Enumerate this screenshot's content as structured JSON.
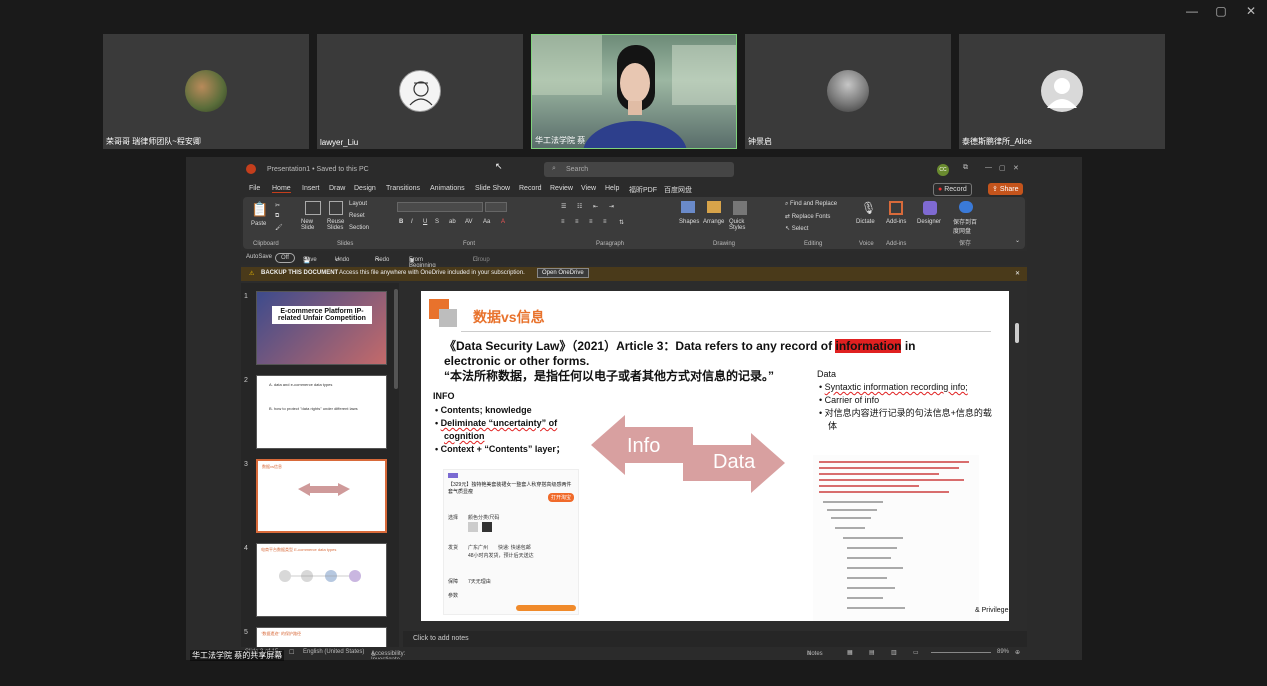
{
  "window": {
    "minimize": "—",
    "maximize": "▢",
    "close": "✕"
  },
  "participants": [
    {
      "name": "荣哥哥 瑞律师团队~程安卿"
    },
    {
      "name": "lawyer_Liu"
    },
    {
      "name": "华工法学院 蔡"
    },
    {
      "name": "钟景启"
    },
    {
      "name": "泰德斯鹏律所_Alice"
    }
  ],
  "ppt": {
    "title": "Presentation1 • Saved to this PC",
    "search_placeholder": "Search",
    "user_initials": "CC",
    "menu": [
      "File",
      "Home",
      "Insert",
      "Draw",
      "Design",
      "Transitions",
      "Animations",
      "Slide Show",
      "Record",
      "Review",
      "View",
      "Help",
      "福昕PDF",
      "百度网盘"
    ],
    "record_btn": "Record",
    "share_btn": "Share",
    "ribbon": {
      "paste": "Paste",
      "new_slide": "New Slide",
      "reuse_slides": "Reuse Slides",
      "layout": "Layout",
      "reset": "Reset",
      "section": "Section",
      "shapes": "Shapes",
      "arrange": "Arrange",
      "quick_styles": "Quick Styles",
      "find_replace": "Find and Replace",
      "replace_fonts": "Replace Fonts",
      "select": "Select",
      "dictate": "Dictate",
      "addins": "Add-ins",
      "designer": "Designer",
      "baidu_save": "保存到百度网盘",
      "groups": [
        "Clipboard",
        "Slides",
        "Font",
        "Paragraph",
        "Drawing",
        "Editing",
        "Voice",
        "Add-ins",
        "保存"
      ]
    },
    "autosave": {
      "label": "AutoSave",
      "state": "Off",
      "save": "Save",
      "undo": "Undo",
      "redo": "Redo",
      "from_beginning": "From Beginning",
      "group": "Group"
    },
    "notice": {
      "title": "BACKUP THIS DOCUMENT",
      "text": "Access this file anywhere with OneDrive included in your subscription.",
      "button": "Open OneDrive"
    },
    "thumbnails": [
      {
        "num": "1",
        "title": "E-commerce Platform IP-related Unfair Competition"
      },
      {
        "num": "2",
        "lines": [
          "A. data and e-commerce data types",
          "B. how to protect \"data rights\" under different laws"
        ]
      },
      {
        "num": "3",
        "title": "数据vs信息",
        "selected": true
      },
      {
        "num": "4",
        "title": "电商平台数据类型 E-commerce data types"
      },
      {
        "num": "5",
        "title": "\"数据遗迹\" 的保护路径"
      }
    ],
    "slide": {
      "heading": "数据vs信息",
      "law_line1_a": "《Data Security Law》（2021）Article 3：Data refers to any record of ",
      "law_highlight": "information",
      "law_line1_b": " in",
      "law_line2": "electronic or other forms.",
      "law_cn": "“本法所称数据，是指任何以电子或者其他方式对信息的记录。”",
      "info_title": "INFO",
      "info_items": [
        "Contents; knowledge",
        "Deliminate “uncertainty” of cognition",
        "Context + “Contents” layer；"
      ],
      "arrow_info": "Info",
      "arrow_data": "Data",
      "data_title": "Data",
      "data_items": [
        "Syntaxtic information recording info;",
        "Carrier of info",
        "对信息内容进行记录的句法信息+信息的载体"
      ],
      "product_price": "【329元】独特艳美套装裙女一整套人秋穿搭高级感两件套气质显瘦",
      "product_buy": "打开淘宝",
      "product_rows": [
        "选择",
        "颜色分类/尺码",
        "发货",
        "广东广州",
        "快递: 快递包邮",
        "48小时内发货，预计后天送达",
        "保障",
        "7天无理由",
        "参数"
      ],
      "footer_text": "& Privilege"
    },
    "notes_placeholder": "Click to add notes",
    "status": {
      "slide": "Slide 3 of 15",
      "language": "English (United States)",
      "accessibility": "Accessibility: Investigate",
      "notes": "Notes",
      "zoom": "89%"
    }
  },
  "share_label": "华工法学院 蔡的共享屏幕"
}
